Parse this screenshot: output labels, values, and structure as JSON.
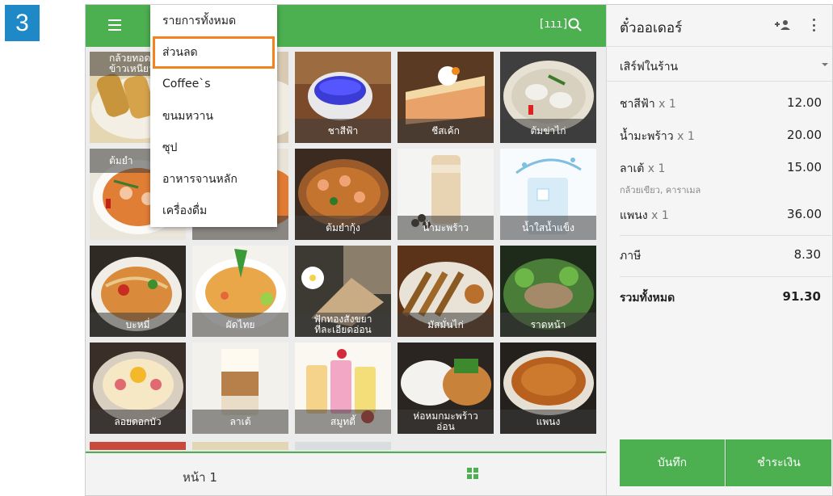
{
  "step_badge": "3",
  "topbar": {
    "barcode_glyph": "[ııı]"
  },
  "dropdown": {
    "items": [
      "รายการทั้งหมด",
      "ส่วนลด",
      "Coffee`s",
      "ขนมหวาน",
      "ซุป",
      "อาหารจานหลัก",
      "เครื่องดื่ม"
    ],
    "highlighted_index": 1,
    "highlight_color": "#f5821f"
  },
  "grid": {
    "tiles": [
      {
        "label": "กล้วยทอด\nข้าวเหนียว",
        "partial": true
      },
      {
        "label": "",
        "partial": true
      },
      {
        "label": "ชาสีฟ้า"
      },
      {
        "label": "ชีสเค้ก"
      },
      {
        "label": "ต้มข่าไก่"
      },
      {
        "label": "ต้มยำ",
        "partial": true
      },
      {
        "label": "",
        "partial": true
      },
      {
        "label": "ต้มยำกุ้ง"
      },
      {
        "label": "น้ำมะพร้าว"
      },
      {
        "label": "น้ำใสน้ำแข็ง"
      },
      {
        "label": "บะหมี่"
      },
      {
        "label": "ผัดไทย"
      },
      {
        "label": "ฟักทองสังขยา\nที่ละเอียดอ่อน"
      },
      {
        "label": "มัสมั่นไก่"
      },
      {
        "label": "ราดหน้า"
      },
      {
        "label": "ลอยดอกบัว"
      },
      {
        "label": "ลาเต้"
      },
      {
        "label": "สมูทตี้"
      },
      {
        "label": "ห่อหมกมะพร้าว\nอ่อน"
      },
      {
        "label": "แพนง"
      }
    ]
  },
  "bottombar": {
    "page_label": "หน้า 1"
  },
  "ticket": {
    "title": "ตั๋วออเดอร์",
    "dining_option": "เสิร์ฟในร้าน",
    "lines": [
      {
        "name": "ชาสีฟ้า",
        "qty": "x 1",
        "price": "12.00",
        "modifiers": ""
      },
      {
        "name": "น้ำมะพร้าว",
        "qty": "x 1",
        "price": "20.00",
        "modifiers": ""
      },
      {
        "name": "ลาเต้",
        "qty": "x 1",
        "price": "15.00",
        "modifiers": "กล้วยเขียว, คาราเมล"
      },
      {
        "name": "แพนง",
        "qty": "x 1",
        "price": "36.00",
        "modifiers": ""
      }
    ],
    "tax_label": "ภาษี",
    "tax_value": "8.30",
    "total_label": "รวมทั้งหมด",
    "total_value": "91.30",
    "save_label": "บันทึก",
    "pay_label": "ชำระเงิน"
  },
  "colors": {
    "brand_green": "#4caf50",
    "badge_blue": "#1f88c7"
  }
}
